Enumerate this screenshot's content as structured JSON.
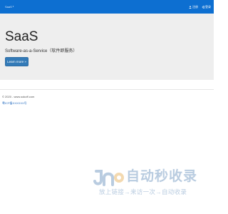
{
  "nav": {
    "brand": "SaaS",
    "links": [
      {
        "icon": "user-icon",
        "label": "注册"
      },
      {
        "icon": "login-icon",
        "label": "登录"
      }
    ]
  },
  "hero": {
    "title": "SaaS",
    "subtitle": "Software-as-a-Service（软件即服务）",
    "button": "Learn more »"
  },
  "footer": {
    "copyright": "© 2020 - www.sokoff.com",
    "icp": "粤ICP备XXXXXX号"
  },
  "watermark": {
    "text": "自动秒收录",
    "subtext": "放上链接→来访一次→自动收录",
    "colors": {
      "primary": "#b9cce0",
      "accent": "#f3d9b0"
    }
  },
  "colors": {
    "navbar": "#0d6fd1",
    "hero_bg": "#eeeeee",
    "button": "#337ab7",
    "link": "#2a6fc2"
  }
}
